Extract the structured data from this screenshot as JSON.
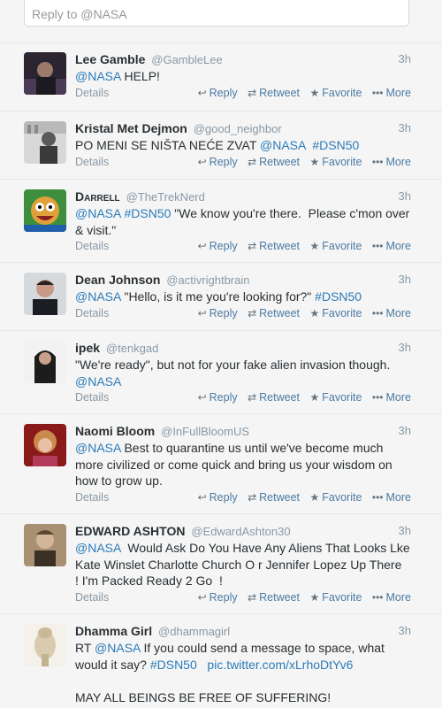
{
  "reply_box": {
    "placeholder": "Reply to @NASA"
  },
  "actions": {
    "details": "Details",
    "reply": "Reply",
    "retweet": "Retweet",
    "favorite": "Favorite",
    "more": "More"
  },
  "tweets": [
    {
      "name": "Lee Gamble",
      "handle": "@GambleLee",
      "time": "3h",
      "text": [
        {
          "t": "@NASA",
          "link": true
        },
        {
          "t": " HELP!",
          "link": false
        }
      ]
    },
    {
      "name": "Kristal Met Dejmon",
      "handle": "@good_neighbor",
      "time": "3h",
      "text": [
        {
          "t": "PO MENI SE NIŠTA NEĆE ZVAT ",
          "link": false
        },
        {
          "t": "@NASA",
          "link": true
        },
        {
          "t": "  ",
          "link": false
        },
        {
          "t": "#DSN50",
          "link": true
        }
      ]
    },
    {
      "name": "Darrell",
      "handle": "@TheTrekNerd",
      "time": "3h",
      "text": [
        {
          "t": "@NASA",
          "link": true
        },
        {
          "t": " ",
          "link": false
        },
        {
          "t": "#DSN50",
          "link": true
        },
        {
          "t": " \"We know you're there.  Please c'mon over & visit.\"",
          "link": false
        }
      ]
    },
    {
      "name": "Dean Johnson",
      "handle": "@activrightbrain",
      "time": "3h",
      "text": [
        {
          "t": "@NASA",
          "link": true
        },
        {
          "t": " \"Hello, is it me you're looking for?\" ",
          "link": false
        },
        {
          "t": "#DSN50",
          "link": true
        }
      ]
    },
    {
      "name": "ipek",
      "handle": "@tenkgad",
      "time": "3h",
      "text": [
        {
          "t": "\"We're ready\", but not for your fake alien invasion though. ",
          "link": false
        },
        {
          "t": "@NASA",
          "link": true
        }
      ]
    },
    {
      "name": "Naomi Bloom",
      "handle": "@InFullBloomUS",
      "time": "3h",
      "text": [
        {
          "t": "@NASA",
          "link": true
        },
        {
          "t": " Best to quarantine us until we've become much more civilized or come quick and bring us your wisdom on how to grow up.",
          "link": false
        }
      ]
    },
    {
      "name": "EDWARD ASHTON",
      "handle": "@EdwardAshton30",
      "time": "3h",
      "text": [
        {
          "t": "@NASA",
          "link": true
        },
        {
          "t": "  Would Ask Do You Have Any Aliens That Looks Lke Kate Winslet Charlotte Church O r Jennifer Lopez Up There  ! I'm Packed Ready 2 Go  !",
          "link": false
        }
      ]
    },
    {
      "name": "Dhamma Girl",
      "handle": "@dhammagirl",
      "time": "3h",
      "text": [
        {
          "t": "RT ",
          "link": false
        },
        {
          "t": "@NASA",
          "link": true
        },
        {
          "t": " If you could send a message to space, what would it say? ",
          "link": false
        },
        {
          "t": "#DSN50",
          "link": true
        },
        {
          "t": "   ",
          "link": false
        },
        {
          "t": "pic.twitter.com/xLrhoDtYv6",
          "link": true
        },
        {
          "t": "\n\nMAY ALL BEINGS BE FREE OF SUFFERING!",
          "link": false
        }
      ]
    }
  ]
}
